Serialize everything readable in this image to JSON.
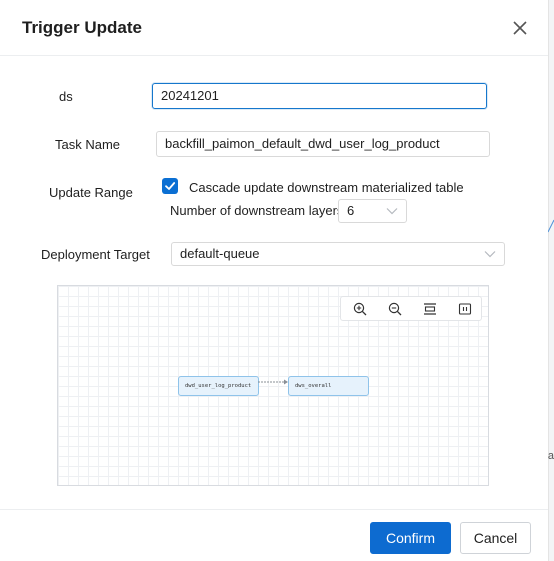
{
  "dialog": {
    "title": "Trigger Update",
    "close_icon": "close-icon"
  },
  "form": {
    "ds": {
      "label": "ds",
      "value": "20241201"
    },
    "task_name": {
      "label": "Task Name",
      "value": "backfill_paimon_default_dwd_user_log_product"
    },
    "update_range": {
      "label": "Update Range",
      "cascade_label": "Cascade update downstream materialized table",
      "cascade_checked": true,
      "layers_label": "Number of downstream layers",
      "layers_value": "6"
    },
    "deployment_target": {
      "label": "Deployment Target",
      "value": "default-queue"
    }
  },
  "graph": {
    "toolbar": [
      "zoom-in-icon",
      "zoom-out-icon",
      "fit-view-icon",
      "fullscreen-icon"
    ],
    "nodes": [
      {
        "label": "dwd_user_log_product"
      },
      {
        "label": "dws_overall"
      }
    ]
  },
  "footer": {
    "confirm_label": "Confirm",
    "cancel_label": "Cancel"
  },
  "background": {
    "edge_text": "a"
  },
  "colors": {
    "primary": "#0d6bd0",
    "node_fill": "#e6f2fc",
    "node_border": "#8fc3ea"
  }
}
